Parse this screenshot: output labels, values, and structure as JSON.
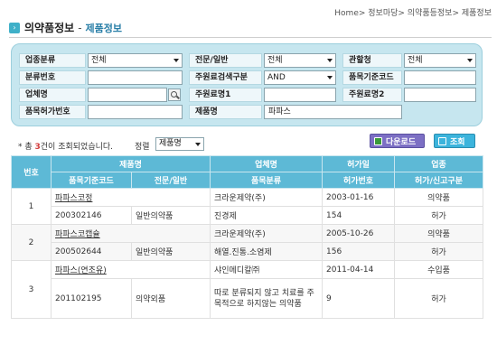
{
  "breadcrumb": "Home> 정보마당> 의약품등정보> 제품정보",
  "title": {
    "main": "의약품정보",
    "sep": "-",
    "sub": "제품정보"
  },
  "search": {
    "row1": {
      "label1": "업종분류",
      "value1": "전체",
      "label2": "전문/일반",
      "value2": "전체",
      "label3": "관할청",
      "value3": "전체"
    },
    "row2": {
      "label1": "분류번호",
      "value1": "",
      "label2": "주원료검색구분",
      "value2": "AND",
      "label3": "품목기준코드",
      "value3": ""
    },
    "row3": {
      "label1": "업체명",
      "value1": "",
      "label2": "주원료명1",
      "value2": "",
      "label3": "주원료명2",
      "value3": ""
    },
    "row4": {
      "label1": "품목허가번호",
      "value1": "",
      "label2": "제품명",
      "value2": "파파스"
    }
  },
  "result": {
    "prefix": "* 총 ",
    "count": "3",
    "suffix": "건이 조회되었습니다."
  },
  "sort": {
    "label": "정렬",
    "value": "제품명"
  },
  "buttons": {
    "download": "다운로드",
    "search": "조회"
  },
  "table": {
    "head1": [
      "번호",
      "제품명",
      "업체명",
      "허가일",
      "업종"
    ],
    "head2": [
      "품목기준코드",
      "전문/일반",
      "품목분류",
      "허가번호",
      "허가/신고구분"
    ],
    "rows": [
      {
        "no": "1",
        "product": "파파스코정",
        "company": "크라운제약(주)",
        "date": "2003-01-16",
        "industry": "의약품",
        "code": "200302146",
        "type": "일반의약품",
        "category": "진경제",
        "permit_no": "154",
        "permit_type": "허가"
      },
      {
        "no": "2",
        "product": "파파스코캡슐",
        "company": "크라운제약(주)",
        "date": "2005-10-26",
        "industry": "의약품",
        "code": "200502644",
        "type": "일반의약품",
        "category": "해열.진통.소염제",
        "permit_no": "156",
        "permit_type": "허가"
      },
      {
        "no": "3",
        "product": "파파스(연조유)",
        "company": "샤인메디칼㈜",
        "date": "2011-04-14",
        "industry": "수입품",
        "code": "201102195",
        "type": "의약외품",
        "category": "따로 분류되지 않고 치료를 주목적으로 하지않는 의약품",
        "permit_no": "9",
        "permit_type": "허가"
      }
    ]
  }
}
